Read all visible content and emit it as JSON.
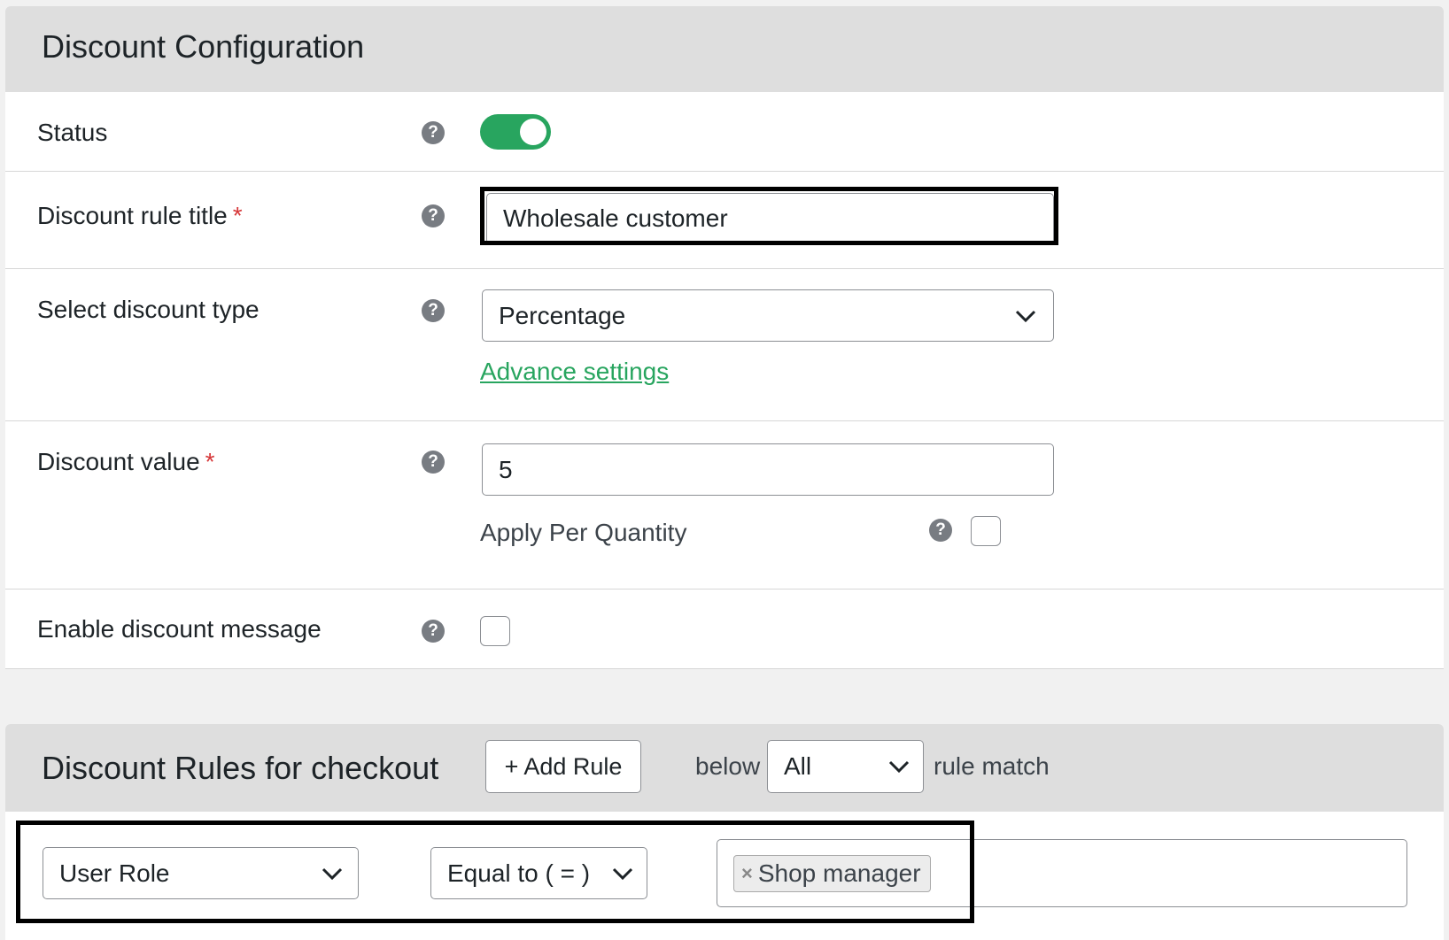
{
  "config_panel": {
    "title": "Discount Configuration",
    "rows": {
      "status": {
        "label": "Status",
        "toggle_on": true
      },
      "title": {
        "label": "Discount rule title",
        "required_mark": "*",
        "value": "Wholesale customer"
      },
      "type": {
        "label": "Select discount type",
        "selected": "Percentage",
        "advance_link": "Advance settings"
      },
      "value": {
        "label": "Discount value",
        "required_mark": "*",
        "value": "5",
        "per_quantity_label": "Apply Per Quantity",
        "per_quantity_checked": false
      },
      "message": {
        "label": "Enable discount message",
        "checked": false
      }
    },
    "help_glyph": "?"
  },
  "rules_panel": {
    "title": "Discount Rules for checkout",
    "add_rule_label": "+ Add Rule",
    "below_label": "below",
    "match_selected": "All",
    "rule_match_label": "rule match",
    "rule": {
      "field": "User Role",
      "operator": "Equal to ( = )",
      "tags": [
        {
          "remove": "×",
          "label": "Shop manager"
        }
      ]
    }
  },
  "colors": {
    "accent_green": "#28a55f",
    "header_bg": "#dedede",
    "required_red": "#d63638"
  },
  "icons": [
    "help-icon",
    "chevron-down-icon",
    "close-icon"
  ]
}
